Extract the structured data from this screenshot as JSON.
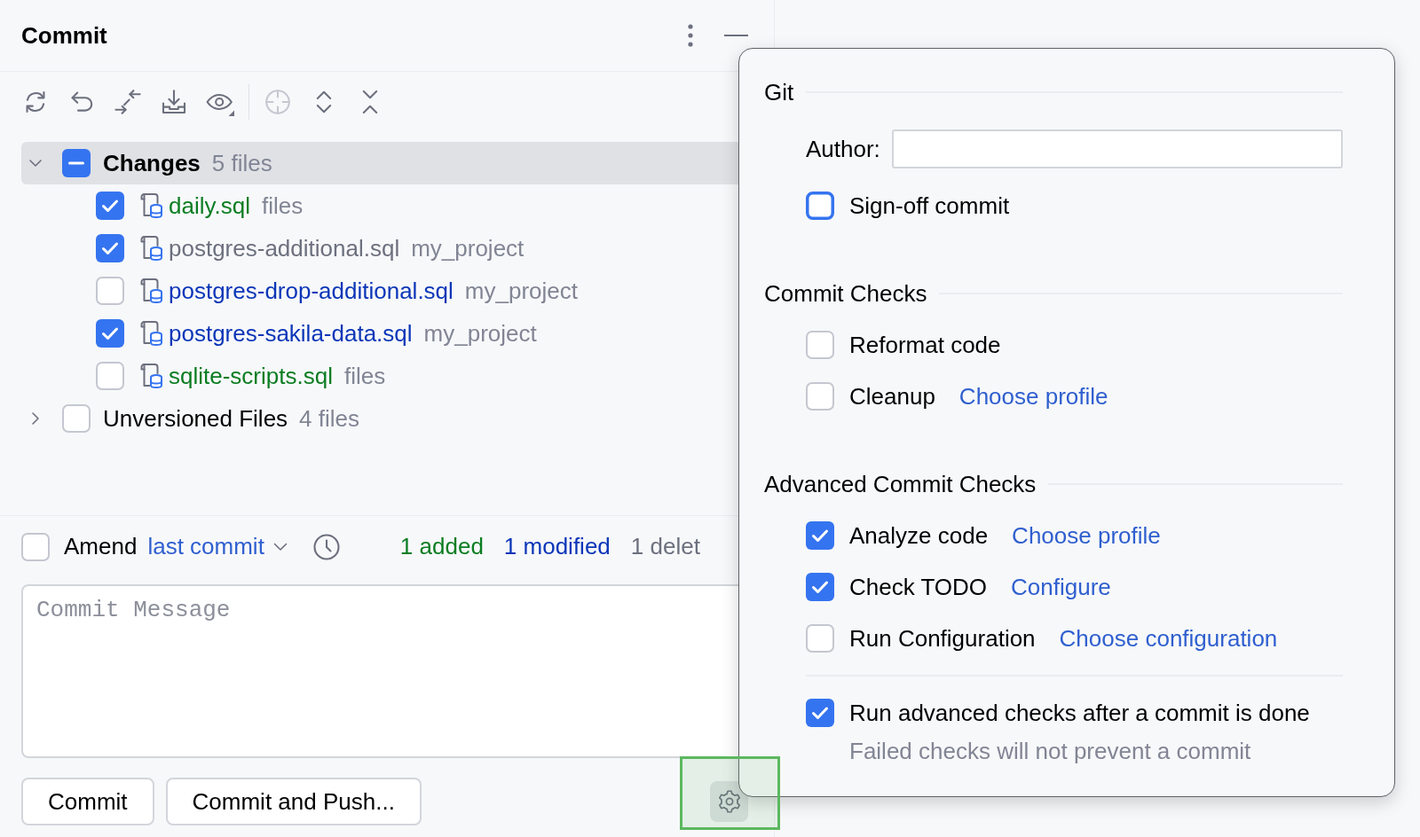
{
  "panel": {
    "title": "Commit"
  },
  "toolbar": [
    [
      {
        "disabled": false
      },
      {
        "disabled": false
      },
      {
        "disabled": false
      },
      {
        "disabled": false
      },
      {
        "disabled": false
      }
    ],
    [
      {
        "disabled": true
      },
      {
        "disabled": false
      },
      {
        "disabled": false
      }
    ]
  ],
  "changes": [
    {
      "label": "Changes",
      "count": "5 files",
      "expanded": true,
      "selected": true,
      "default": true,
      "checked": false,
      "mixed": true,
      "children": [
        {
          "name": "daily.sql",
          "location": "files",
          "selected": false,
          "checked": true,
          "color": "#0b7d21"
        },
        {
          "name": "postgres-additional.sql",
          "location": "my_project",
          "selected": false,
          "checked": true,
          "color": "#6c707e"
        },
        {
          "name": "postgres-drop-additional.sql",
          "location": "my_project",
          "selected": false,
          "checked": false,
          "color": "#0b36b8"
        },
        {
          "name": "postgres-sakila-data.sql",
          "location": "my_project",
          "selected": false,
          "checked": true,
          "color": "#0b36b8"
        },
        {
          "name": "sqlite-scripts.sql",
          "location": "files",
          "selected": false,
          "checked": false,
          "color": "#0b7d21"
        }
      ]
    },
    {
      "label": "Unversioned Files",
      "count": "4 files",
      "expanded": false,
      "selected": false,
      "default": false,
      "checked": false,
      "mixed": false
    }
  ],
  "amend": {
    "label": "Amend",
    "checked": false,
    "target": "last commit"
  },
  "stats": [
    {
      "text": "1 added",
      "color": "#0b7d21"
    },
    {
      "text": "1 modified",
      "color": "#0b36b8"
    },
    {
      "text": "1 delet",
      "color": "#6c707e"
    }
  ],
  "commit_message": {
    "placeholder": "Commit Message"
  },
  "buttons": [
    "Commit",
    "Commit and Push..."
  ],
  "settings_button": {
    "selected": true,
    "highlighted": true
  },
  "popup": {
    "sections": [
      {
        "title": "Git",
        "items": [
          {
            "kind": "field",
            "label": "Author:"
          },
          {
            "kind": "checkbox",
            "label": "Sign-off commit",
            "checked": false,
            "focused": true
          }
        ]
      },
      {
        "title": "Commit Checks",
        "items": [
          {
            "kind": "checkbox",
            "label": "Reformat code",
            "checked": false,
            "focused": false
          },
          {
            "kind": "checkbox",
            "label": "Cleanup",
            "checked": false,
            "focused": false,
            "link": "Choose profile"
          }
        ]
      },
      {
        "title": "Advanced Commit Checks",
        "items": [
          {
            "kind": "checkbox",
            "label": "Analyze code",
            "checked": true,
            "focused": false,
            "link": "Choose profile"
          },
          {
            "kind": "checkbox",
            "label": "Check TODO",
            "checked": true,
            "focused": false,
            "link": "Configure"
          },
          {
            "kind": "checkbox",
            "label": "Run Configuration",
            "checked": false,
            "focused": false,
            "link": "Choose configuration"
          },
          {
            "kind": "separator"
          },
          {
            "kind": "checkbox",
            "label": "Run advanced checks after a commit is done",
            "checked": true,
            "focused": false,
            "note": "Failed checks will not prevent a commit"
          }
        ]
      }
    ]
  }
}
